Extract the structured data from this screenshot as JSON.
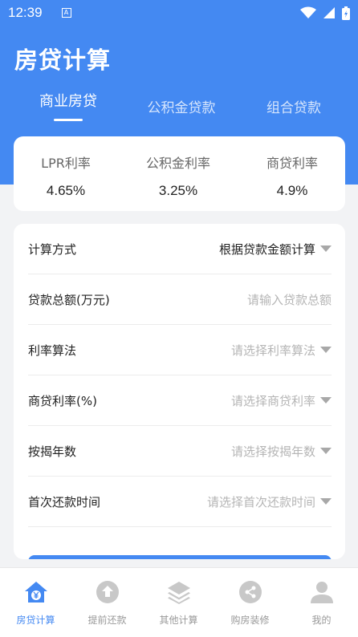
{
  "status_bar": {
    "time": "12:39",
    "badge": "A"
  },
  "app": {
    "title": "房贷计算"
  },
  "tabs": [
    {
      "label": "商业房贷",
      "active": true
    },
    {
      "label": "公积金贷款",
      "active": false
    },
    {
      "label": "组合贷款",
      "active": false
    }
  ],
  "rates": [
    {
      "label": "LPR利率",
      "value": "4.65%"
    },
    {
      "label": "公积金利率",
      "value": "3.25%"
    },
    {
      "label": "商贷利率",
      "value": "4.9%"
    }
  ],
  "form": {
    "rows": [
      {
        "label": "计算方式",
        "value": "根据贷款金额计算",
        "filled": true,
        "dropdown": true
      },
      {
        "label": "贷款总额(万元)",
        "value": "请输入贷款总额",
        "filled": false,
        "dropdown": false
      },
      {
        "label": "利率算法",
        "value": "请选择利率算法",
        "filled": false,
        "dropdown": true
      },
      {
        "label": "商贷利率(%)",
        "value": "请选择商贷利率",
        "filled": false,
        "dropdown": true
      },
      {
        "label": "按揭年数",
        "value": "请选择按揭年数",
        "filled": false,
        "dropdown": true
      },
      {
        "label": "首次还款时间",
        "value": "请选择首次还款时间",
        "filled": false,
        "dropdown": true
      }
    ]
  },
  "bottom_nav": [
    {
      "label": "房贷计算",
      "icon": "house-yuan-icon",
      "active": true
    },
    {
      "label": "提前还款",
      "icon": "upload-circle-icon",
      "active": false
    },
    {
      "label": "其他计算",
      "icon": "layers-icon",
      "active": false
    },
    {
      "label": "购房装修",
      "icon": "share-circle-icon",
      "active": false
    },
    {
      "label": "我的",
      "icon": "user-icon",
      "active": false
    }
  ],
  "colors": {
    "primary": "#4489f2",
    "background": "#f2f3f5",
    "placeholder": "#b5b5b5",
    "inactive": "#999999"
  }
}
